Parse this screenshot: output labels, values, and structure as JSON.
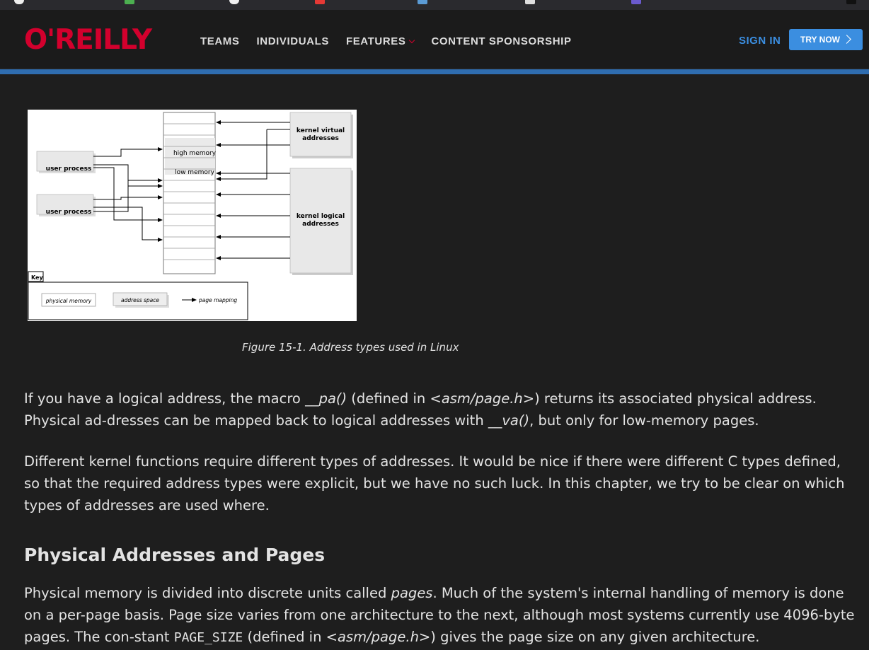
{
  "header": {
    "logo": "O'REILLY",
    "nav": [
      "TEAMS",
      "INDIVIDUALS",
      "FEATURES",
      "CONTENT SPONSORSHIP"
    ],
    "signin": "SIGN IN",
    "trynow": "TRY NOW"
  },
  "figure": {
    "labels": {
      "kernel_virtual": [
        "kernel virtual",
        "addresses"
      ],
      "kernel_logical": [
        "kernel logical",
        "addresses"
      ],
      "high_memory": "high memory",
      "low_memory": "low memory",
      "user_process": "user process",
      "key": "Key",
      "physical_memory": "physical memory",
      "address_space": "address space",
      "page_mapping": "page mapping"
    },
    "caption": "Figure 15-1. Address types used in Linux"
  },
  "content": {
    "p1": {
      "a": "If you have a logical address, the macro ",
      "code1": "__pa()",
      "b": " (defined in ",
      "file1": "<asm/page.h>",
      "c": ") returns its associated physical address. Physical ad-dresses can be mapped back to logical addresses with ",
      "code2": "__va()",
      "d": ", but only for low-memory pages."
    },
    "p2": "Different kernel functions require different types of addresses. It would be nice if there were different C types defined, so that the required address types were explicit, but we have no such luck. In this chapter, we try to be clear on which types of addresses are used where.",
    "h2": "Physical Addresses and Pages",
    "p3": {
      "a": "Physical memory is divided into discrete units called ",
      "em": "pages",
      "b": ". Much of the system's internal handling of memory is done on a per-page basis. Page size varies from one architecture to the next, although most systems currently use 4096-byte pages. The con-stant ",
      "code": "PAGE_SIZE",
      "c": " (defined in ",
      "file": "<asm/page.h>",
      "d": ") gives the page size on any given architecture."
    }
  },
  "colors": {
    "accent": "#2f6db0",
    "brand": "#d3002d",
    "link": "#3b8ee0"
  }
}
